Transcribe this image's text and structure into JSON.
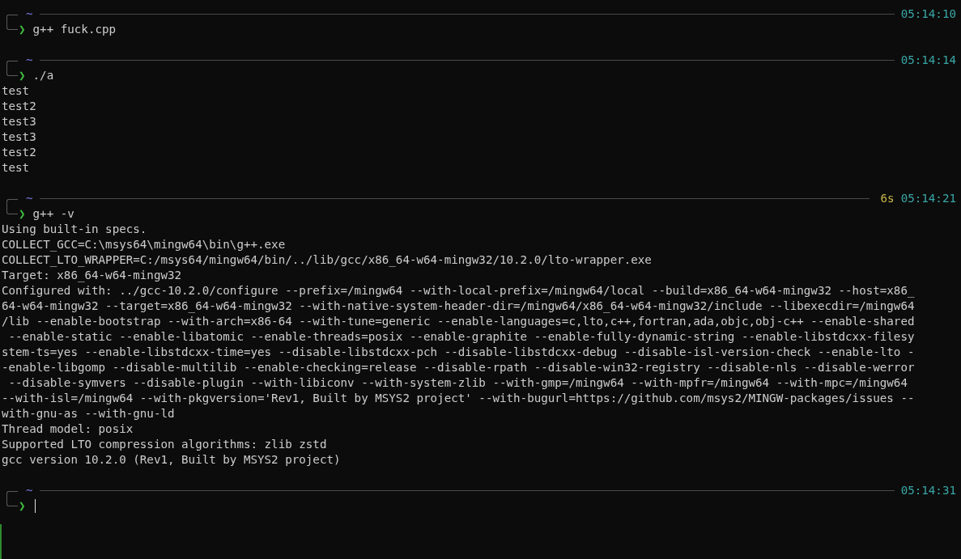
{
  "blocks": [
    {
      "directory": "~",
      "time": "05:14:10",
      "prompt_symbol": "❯",
      "command": "g++ fuck.cpp"
    },
    {
      "directory": "~",
      "time": "05:14:14",
      "prompt_symbol": "❯",
      "command": "./a",
      "output": [
        "test",
        "test2",
        "test3",
        "test3",
        "test2",
        "test"
      ]
    },
    {
      "directory": "~",
      "duration": "6s",
      "time": "05:14:21",
      "prompt_symbol": "❯",
      "command": "g++ -v",
      "output": [
        "Using built-in specs.",
        "COLLECT_GCC=C:\\msys64\\mingw64\\bin\\g++.exe",
        "COLLECT_LTO_WRAPPER=C:/msys64/mingw64/bin/../lib/gcc/x86_64-w64-mingw32/10.2.0/lto-wrapper.exe",
        "Target: x86_64-w64-mingw32",
        "Configured with: ../gcc-10.2.0/configure --prefix=/mingw64 --with-local-prefix=/mingw64/local --build=x86_64-w64-mingw32 --host=x86_",
        "64-w64-mingw32 --target=x86_64-w64-mingw32 --with-native-system-header-dir=/mingw64/x86_64-w64-mingw32/include --libexecdir=/mingw64",
        "/lib --enable-bootstrap --with-arch=x86-64 --with-tune=generic --enable-languages=c,lto,c++,fortran,ada,objc,obj-c++ --enable-shared",
        " --enable-static --enable-libatomic --enable-threads=posix --enable-graphite --enable-fully-dynamic-string --enable-libstdcxx-filesy",
        "stem-ts=yes --enable-libstdcxx-time=yes --disable-libstdcxx-pch --disable-libstdcxx-debug --disable-isl-version-check --enable-lto -",
        "-enable-libgomp --disable-multilib --enable-checking=release --disable-rpath --disable-win32-registry --disable-nls --disable-werror",
        " --disable-symvers --disable-plugin --with-libiconv --with-system-zlib --with-gmp=/mingw64 --with-mpfr=/mingw64 --with-mpc=/mingw64",
        "--with-isl=/mingw64 --with-pkgversion='Rev1, Built by MSYS2 project' --with-bugurl=https://github.com/msys2/MINGW-packages/issues --",
        "with-gnu-as --with-gnu-ld",
        "Thread model: posix",
        "Supported LTO compression algorithms: zlib zstd",
        "gcc version 10.2.0 (Rev1, Built by MSYS2 project)"
      ]
    },
    {
      "directory": "~",
      "time": "05:14:31",
      "prompt_symbol": "❯",
      "cursor": true
    }
  ]
}
